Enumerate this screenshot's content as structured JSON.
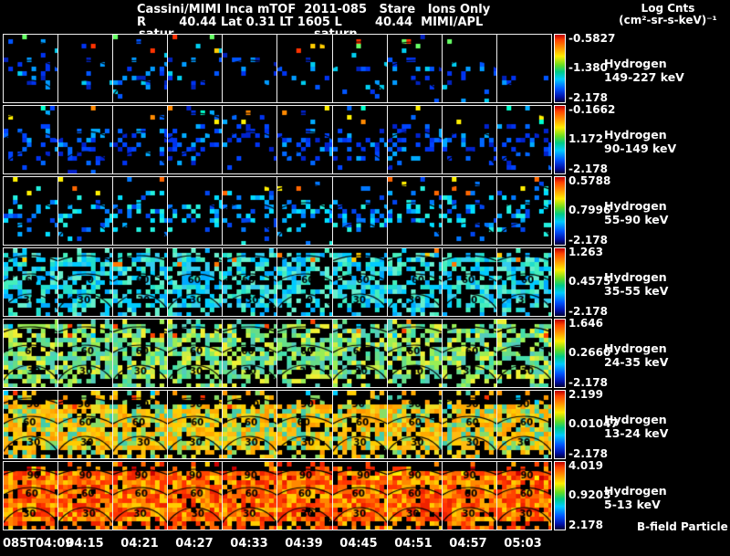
{
  "chart_data": {
    "type": "heatmap",
    "title": "Cassini/MIMI Inca mTOF  2011-085   Stare   Ions Only",
    "subtitle": "R        40.44 Lat 0.31 LT 1605 L        40.44  MIMI/APL",
    "colorbar_units_line1": "Log Cnts",
    "colorbar_units_line2": "(cm²-sr-s-keV)⁻¹",
    "marker1": "satur",
    "marker2": "saturn",
    "bfield_label": "B-field Particle Flow",
    "x_ticks": [
      "085T04:09",
      "04:15",
      "04:21",
      "04:27",
      "04:33",
      "04:39",
      "04:45",
      "04:51",
      "04:57",
      "05:03"
    ],
    "contour_labels_deg": [
      "30",
      "60",
      "90"
    ],
    "colorbar_stops": [
      "#bb0000 0%",
      "#ff4400 8%",
      "#ff9900 20%",
      "#ffee00 32%",
      "#66dd22 45%",
      "#00cc88 55%",
      "#00ccff 66%",
      "#0055ff 80%",
      "#0011aa 92%",
      "#000033 100%"
    ],
    "rows": [
      {
        "species": "Hydrogen",
        "energy": "149-227 keV",
        "cbar": {
          "top": "-0.5827",
          "mid": "-1.380",
          "bottom": "-2.178"
        },
        "render": {
          "profile": "band",
          "density": 0.15,
          "top_cut": 0,
          "palette": [
            "#0022bb",
            "#0033ee",
            "#0055ff",
            "#0099ff",
            "#00ccee"
          ],
          "accents": [
            "#ffcc00",
            "#ff3300",
            "#66ff66"
          ],
          "arc_labels": []
        }
      },
      {
        "species": "Hydrogen",
        "energy": "90-149 keV",
        "cbar": {
          "top": "-0.1662",
          "mid": "1.172",
          "bottom": "-2.178"
        },
        "render": {
          "profile": "band",
          "density": 0.3,
          "top_cut": 0,
          "palette": [
            "#0022cc",
            "#0044ff",
            "#0066ff",
            "#00aaff",
            "#0033ee"
          ],
          "accents": [
            "#ffee00",
            "#ff8800",
            "#00ffcc"
          ],
          "arc_labels": []
        }
      },
      {
        "species": "Hydrogen",
        "energy": "55-90 keV",
        "cbar": {
          "top": "0.5788",
          "mid": "0.7996",
          "bottom": "-2.178"
        },
        "render": {
          "profile": "band",
          "density": 0.38,
          "top_cut": 0,
          "palette": [
            "#0044ee",
            "#0077ff",
            "#00aaff",
            "#00ddff",
            "#22eedd"
          ],
          "accents": [
            "#ffee00",
            "#ff6600"
          ],
          "arc_labels": []
        }
      },
      {
        "species": "Hydrogen",
        "energy": "35-55 keV",
        "cbar": {
          "top": "1.263",
          "mid": "0.4575",
          "bottom": "-2.178"
        },
        "render": {
          "profile": "fill",
          "density": 0.58,
          "top_cut": 0.05,
          "palette": [
            "#00ccff",
            "#22ddcc",
            "#44eebb",
            "#00aaff",
            "#66eecc",
            "#33ccee"
          ],
          "accents": [
            "#ffcc00",
            "#ff7700"
          ],
          "arc_labels": [
            "60",
            "30"
          ]
        }
      },
      {
        "species": "Hydrogen",
        "energy": "24-35 keV",
        "cbar": {
          "top": "1.646",
          "mid": "0.2660",
          "bottom": "-2.178"
        },
        "render": {
          "profile": "fill",
          "density": 0.68,
          "top_cut": 0.05,
          "palette": [
            "#66dd88",
            "#99ee55",
            "#ccee44",
            "#44ddaa",
            "#eeee33",
            "#55ccbb"
          ],
          "accents": [
            "#ff8800",
            "#ff4400",
            "#00ccff"
          ],
          "arc_labels": [
            "60",
            "30"
          ]
        }
      },
      {
        "species": "Hydrogen",
        "energy": "13-24 keV",
        "cbar": {
          "top": "2.199",
          "mid": "0.01047",
          "bottom": "-2.178"
        },
        "render": {
          "profile": "fill",
          "density": 0.88,
          "top_cut": 0.16,
          "palette": [
            "#ffcc00",
            "#ffaa00",
            "#ff9900",
            "#eedd22",
            "#88dd66",
            "#44ccaa",
            "#ffbb11"
          ],
          "accents": [
            "#ff3300",
            "#00ccff"
          ],
          "arc_labels": [
            "90",
            "60",
            "30"
          ]
        }
      },
      {
        "species": "Hydrogen",
        "energy": "5-13 keV",
        "cbar": {
          "top": "4.019",
          "mid": "0.9203",
          "bottom": "2.178"
        },
        "render": {
          "profile": "fill",
          "density": 0.95,
          "top_cut": 0.1,
          "palette": [
            "#ff6600",
            "#ff4400",
            "#ff3300",
            "#ff8800",
            "#ffaa00",
            "#ffcc00",
            "#ee2200"
          ],
          "accents": [
            "#ffee00",
            "#cc0000"
          ],
          "arc_labels": [
            "90",
            "60",
            "30"
          ]
        }
      }
    ]
  }
}
